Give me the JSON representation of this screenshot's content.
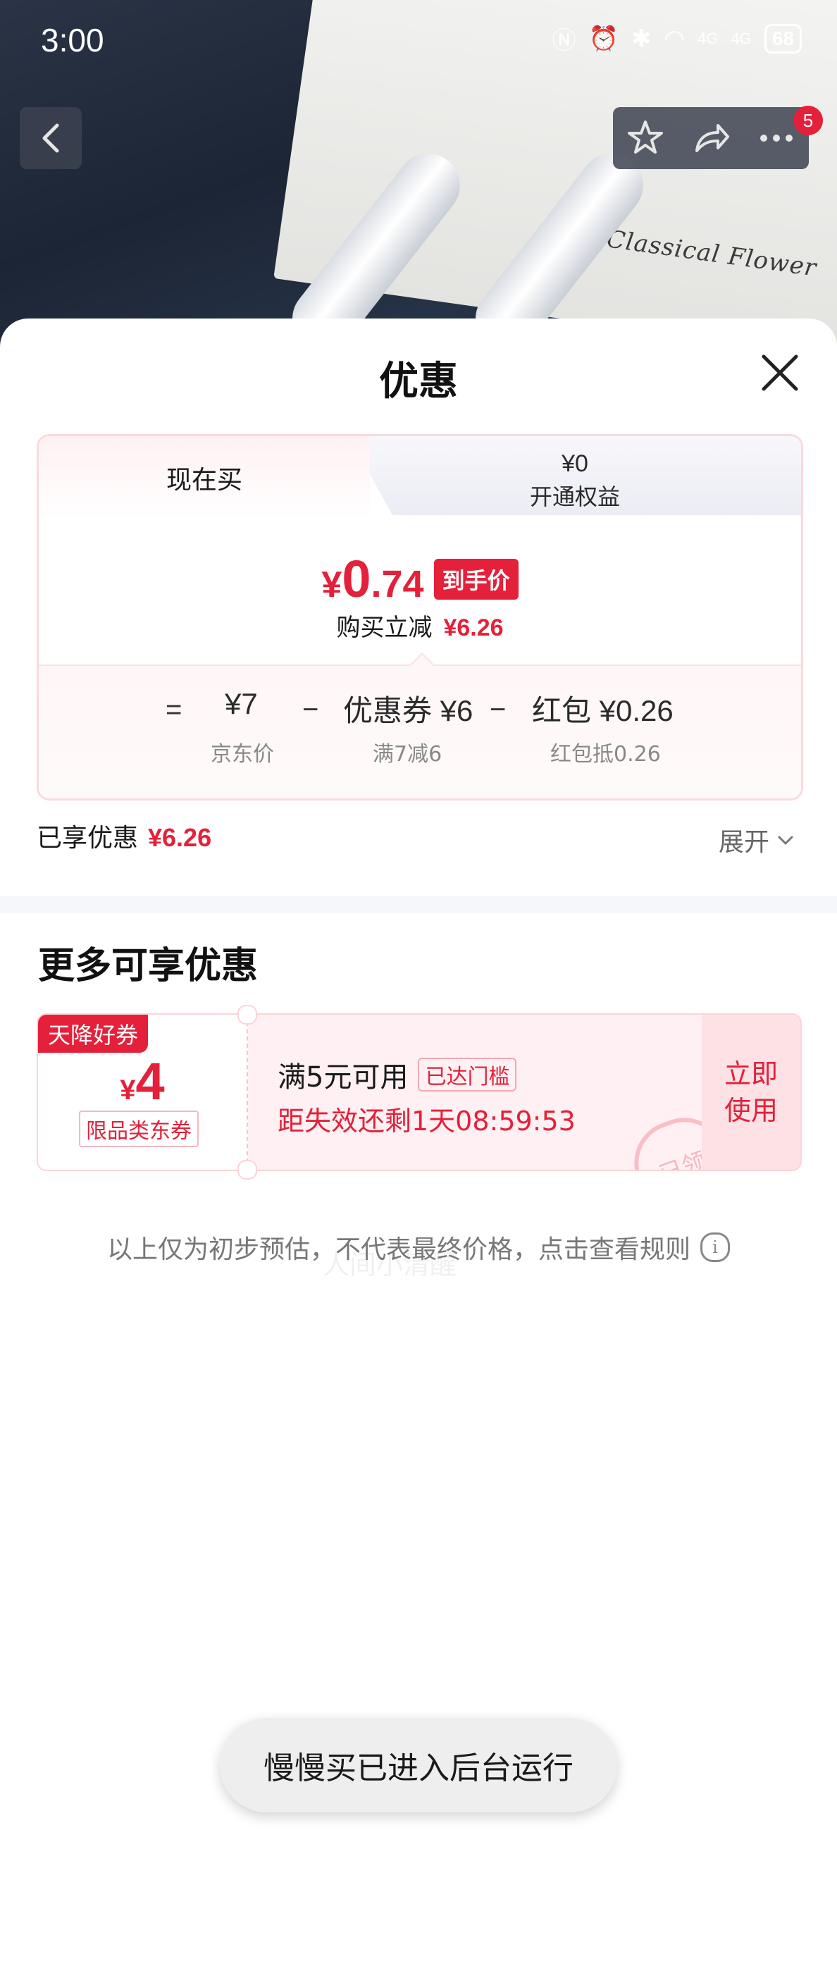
{
  "status_bar": {
    "time": "3:00",
    "signal1": "4G",
    "signal2": "4G",
    "battery": "68"
  },
  "nav": {
    "back_icon": "chevron-left-icon",
    "favorite_icon": "star-icon",
    "share_icon": "share-icon",
    "more_icon": "more-icon",
    "badge_count": "5"
  },
  "product_image": {
    "box_text": "Classical Flower"
  },
  "sheet": {
    "title": "优惠",
    "close_icon": "close-icon"
  },
  "price_card": {
    "tab_now": "现在买",
    "tab_member_value": "¥0",
    "tab_member_label": "开通权益",
    "final_currency": "¥",
    "final_int": "0",
    "final_dec": ".74",
    "final_tag": "到手价",
    "reduce_label": "购买立减",
    "reduce_amount": "¥6.26",
    "breakdown": {
      "eq": "=",
      "jd_price": "¥7",
      "jd_label": "京东价",
      "minus1": "−",
      "coupon_value": "优惠券 ¥6",
      "coupon_label": "满7减6",
      "minus2": "−",
      "redpacket_value": "红包 ¥0.26",
      "redpacket_label": "红包抵0.26"
    }
  },
  "enjoyed": {
    "label": "已享优惠",
    "amount": "¥6.26",
    "expand": "展开"
  },
  "more": {
    "title": "更多可享优惠",
    "coupon": {
      "ribbon": "天降好券",
      "currency": "¥",
      "amount": "4",
      "type": "限品类东券",
      "condition": "满5元可用",
      "threshold_tag": "已达门槛",
      "expire": "距失效还剩1天08:59:53",
      "use_button": "立即使用",
      "stamp": "已领"
    }
  },
  "disclaimer": "以上仅为初步预估，不代表最终价格，点击查看规则",
  "watermark": "人间小清醒",
  "toast": "慢慢买已进入后台运行",
  "colors": {
    "accent_red": "#e4203a",
    "card_border": "#fbd9dd"
  }
}
